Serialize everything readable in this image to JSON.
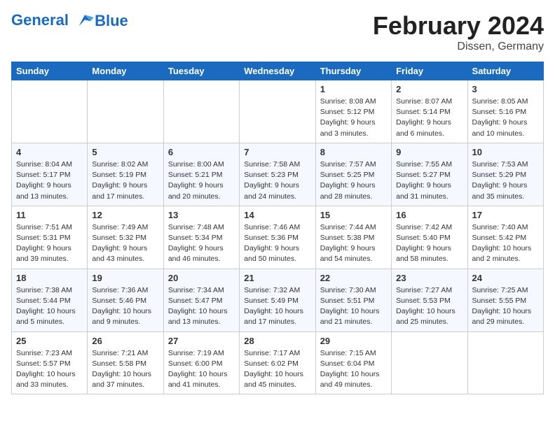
{
  "header": {
    "logo_line1": "General",
    "logo_line2": "Blue",
    "month": "February 2024",
    "location": "Dissen, Germany"
  },
  "weekdays": [
    "Sunday",
    "Monday",
    "Tuesday",
    "Wednesday",
    "Thursday",
    "Friday",
    "Saturday"
  ],
  "weeks": [
    [
      {
        "day": "",
        "info": ""
      },
      {
        "day": "",
        "info": ""
      },
      {
        "day": "",
        "info": ""
      },
      {
        "day": "",
        "info": ""
      },
      {
        "day": "1",
        "info": "Sunrise: 8:08 AM\nSunset: 5:12 PM\nDaylight: 9 hours\nand 3 minutes."
      },
      {
        "day": "2",
        "info": "Sunrise: 8:07 AM\nSunset: 5:14 PM\nDaylight: 9 hours\nand 6 minutes."
      },
      {
        "day": "3",
        "info": "Sunrise: 8:05 AM\nSunset: 5:16 PM\nDaylight: 9 hours\nand 10 minutes."
      }
    ],
    [
      {
        "day": "4",
        "info": "Sunrise: 8:04 AM\nSunset: 5:17 PM\nDaylight: 9 hours\nand 13 minutes."
      },
      {
        "day": "5",
        "info": "Sunrise: 8:02 AM\nSunset: 5:19 PM\nDaylight: 9 hours\nand 17 minutes."
      },
      {
        "day": "6",
        "info": "Sunrise: 8:00 AM\nSunset: 5:21 PM\nDaylight: 9 hours\nand 20 minutes."
      },
      {
        "day": "7",
        "info": "Sunrise: 7:58 AM\nSunset: 5:23 PM\nDaylight: 9 hours\nand 24 minutes."
      },
      {
        "day": "8",
        "info": "Sunrise: 7:57 AM\nSunset: 5:25 PM\nDaylight: 9 hours\nand 28 minutes."
      },
      {
        "day": "9",
        "info": "Sunrise: 7:55 AM\nSunset: 5:27 PM\nDaylight: 9 hours\nand 31 minutes."
      },
      {
        "day": "10",
        "info": "Sunrise: 7:53 AM\nSunset: 5:29 PM\nDaylight: 9 hours\nand 35 minutes."
      }
    ],
    [
      {
        "day": "11",
        "info": "Sunrise: 7:51 AM\nSunset: 5:31 PM\nDaylight: 9 hours\nand 39 minutes."
      },
      {
        "day": "12",
        "info": "Sunrise: 7:49 AM\nSunset: 5:32 PM\nDaylight: 9 hours\nand 43 minutes."
      },
      {
        "day": "13",
        "info": "Sunrise: 7:48 AM\nSunset: 5:34 PM\nDaylight: 9 hours\nand 46 minutes."
      },
      {
        "day": "14",
        "info": "Sunrise: 7:46 AM\nSunset: 5:36 PM\nDaylight: 9 hours\nand 50 minutes."
      },
      {
        "day": "15",
        "info": "Sunrise: 7:44 AM\nSunset: 5:38 PM\nDaylight: 9 hours\nand 54 minutes."
      },
      {
        "day": "16",
        "info": "Sunrise: 7:42 AM\nSunset: 5:40 PM\nDaylight: 9 hours\nand 58 minutes."
      },
      {
        "day": "17",
        "info": "Sunrise: 7:40 AM\nSunset: 5:42 PM\nDaylight: 10 hours\nand 2 minutes."
      }
    ],
    [
      {
        "day": "18",
        "info": "Sunrise: 7:38 AM\nSunset: 5:44 PM\nDaylight: 10 hours\nand 5 minutes."
      },
      {
        "day": "19",
        "info": "Sunrise: 7:36 AM\nSunset: 5:46 PM\nDaylight: 10 hours\nand 9 minutes."
      },
      {
        "day": "20",
        "info": "Sunrise: 7:34 AM\nSunset: 5:47 PM\nDaylight: 10 hours\nand 13 minutes."
      },
      {
        "day": "21",
        "info": "Sunrise: 7:32 AM\nSunset: 5:49 PM\nDaylight: 10 hours\nand 17 minutes."
      },
      {
        "day": "22",
        "info": "Sunrise: 7:30 AM\nSunset: 5:51 PM\nDaylight: 10 hours\nand 21 minutes."
      },
      {
        "day": "23",
        "info": "Sunrise: 7:27 AM\nSunset: 5:53 PM\nDaylight: 10 hours\nand 25 minutes."
      },
      {
        "day": "24",
        "info": "Sunrise: 7:25 AM\nSunset: 5:55 PM\nDaylight: 10 hours\nand 29 minutes."
      }
    ],
    [
      {
        "day": "25",
        "info": "Sunrise: 7:23 AM\nSunset: 5:57 PM\nDaylight: 10 hours\nand 33 minutes."
      },
      {
        "day": "26",
        "info": "Sunrise: 7:21 AM\nSunset: 5:58 PM\nDaylight: 10 hours\nand 37 minutes."
      },
      {
        "day": "27",
        "info": "Sunrise: 7:19 AM\nSunset: 6:00 PM\nDaylight: 10 hours\nand 41 minutes."
      },
      {
        "day": "28",
        "info": "Sunrise: 7:17 AM\nSunset: 6:02 PM\nDaylight: 10 hours\nand 45 minutes."
      },
      {
        "day": "29",
        "info": "Sunrise: 7:15 AM\nSunset: 6:04 PM\nDaylight: 10 hours\nand 49 minutes."
      },
      {
        "day": "",
        "info": ""
      },
      {
        "day": "",
        "info": ""
      }
    ]
  ]
}
